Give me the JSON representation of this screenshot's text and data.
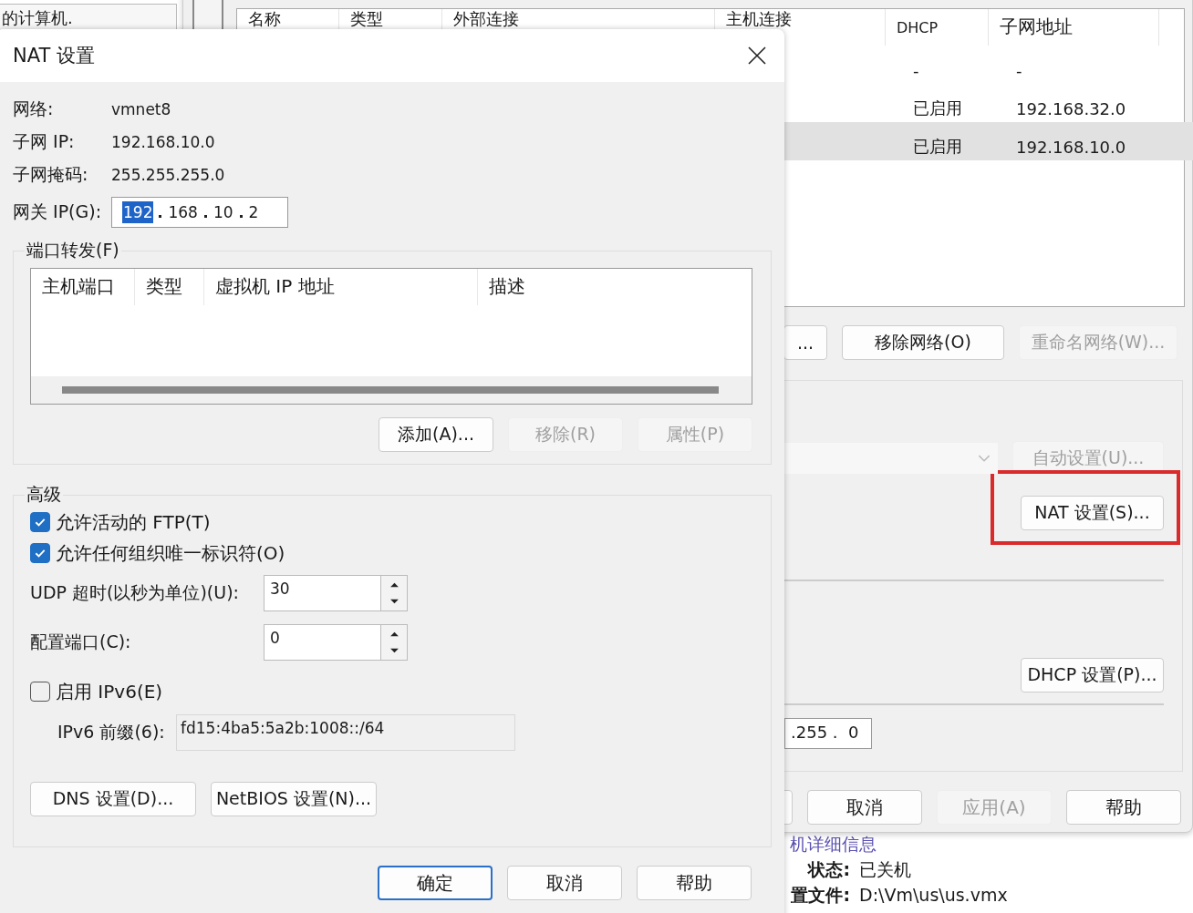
{
  "background_app": {
    "heading": "的计算机.",
    "details_heading": "机详细信息",
    "details": [
      {
        "label": "状态:",
        "value": "已关机"
      },
      {
        "label": "置文件:",
        "value": "D:\\Vm\\us\\us.vmx"
      }
    ]
  },
  "network_editor": {
    "columns": [
      "名称",
      "类型",
      "外部连接",
      "主机连接",
      "DHCP",
      "子网地址"
    ],
    "rows": [
      {
        "dhcp": "-",
        "subnet": "-",
        "selected": false
      },
      {
        "dhcp": "已启用",
        "subnet": "192.168.32.0",
        "selected": false
      },
      {
        "dhcp": "已启用",
        "subnet": "192.168.10.0",
        "selected": true
      }
    ],
    "network_buttons": [
      {
        "label": "...",
        "disabled": false
      },
      {
        "label": "移除网络(O)",
        "disabled": false
      },
      {
        "label": "重命名网络(W)...",
        "disabled": true
      }
    ],
    "auto_button": {
      "label": "自动设置(U)...",
      "disabled": true
    },
    "nat_button": {
      "label": "NAT 设置(S)...",
      "highlighted": true
    },
    "dhcp_button": {
      "label": "DHCP 设置(P)..."
    },
    "subnet_mask": ".255 .  0",
    "footer_buttons": [
      {
        "label": "取消",
        "disabled": false
      },
      {
        "label": "应用(A)",
        "disabled": true
      },
      {
        "label": "帮助",
        "disabled": false
      }
    ]
  },
  "nat_dialog": {
    "title": "NAT 设置",
    "info": [
      {
        "label": "网络:",
        "value": "vmnet8"
      },
      {
        "label": "子网 IP:",
        "value": "192.168.10.0"
      },
      {
        "label": "子网掩码:",
        "value": "255.255.255.0"
      }
    ],
    "gateway": {
      "label": "网关 IP(G):",
      "octets": [
        {
          "text": "192",
          "selected": true
        },
        {
          "text": "168",
          "selected": false
        },
        {
          "text": "10",
          "selected": false
        },
        {
          "text": "2",
          "selected": false
        }
      ]
    },
    "port_forwarding": {
      "title": "端口转发(F)",
      "columns": [
        "主机端口",
        "类型",
        "虚拟机 IP 地址",
        "描述"
      ],
      "buttons": [
        {
          "label": "添加(A)...",
          "disabled": false
        },
        {
          "label": "移除(R)",
          "disabled": true
        },
        {
          "label": "属性(P)",
          "disabled": true
        }
      ]
    },
    "advanced": {
      "title": "高级",
      "checkboxes": [
        {
          "label": "允许活动的 FTP(T)",
          "checked": true
        },
        {
          "label": "允许任何组织唯一标识符(O)",
          "checked": true
        }
      ],
      "spinners": [
        {
          "label": "UDP 超时(以秒为单位)(U):",
          "value": "30"
        },
        {
          "label": "配置端口(C):",
          "value": "0"
        }
      ],
      "ipv6": {
        "label": "启用 IPv6(E)",
        "checked": false
      },
      "prefix": {
        "label": "IPv6 前缀(6):",
        "value": "fd15:4ba5:5a2b:1008::/64",
        "disabled": true
      },
      "buttons": [
        "DNS 设置(D)...",
        "NetBIOS 设置(N)..."
      ]
    },
    "footer_buttons": [
      {
        "label": "确定",
        "default": true
      },
      {
        "label": "取消",
        "default": false
      },
      {
        "label": "帮助",
        "default": false
      }
    ]
  }
}
